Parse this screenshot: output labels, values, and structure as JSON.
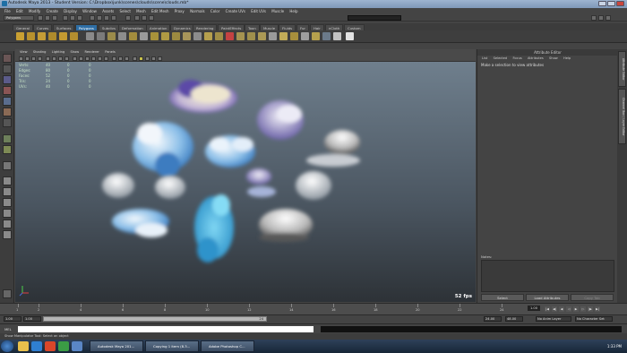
{
  "window": {
    "title": "Autodesk Maya 2013 - Student Version: C:\\Dropbox\\junk\\scenes\\clouds\\scene\\clouds.mb*"
  },
  "menubar": [
    "File",
    "Edit",
    "Modify",
    "Create",
    "Display",
    "Window",
    "Assets",
    "Select",
    "Mesh",
    "Edit Mesh",
    "Proxy",
    "Normals",
    "Color",
    "Create UVs",
    "Edit UVs",
    "Muscle",
    "Help"
  ],
  "status_line": {
    "mode": "Polygons"
  },
  "shelf_tabs": [
    "General",
    "Curves",
    "Surfaces",
    "Polygons",
    "Subdivs",
    "Deformation",
    "Animation",
    "Dynamics",
    "Rendering",
    "PaintEffects",
    "Toon",
    "Muscle",
    "Fluids",
    "Fur",
    "Hair",
    "nCloth",
    "Custom"
  ],
  "active_shelf_tab": "Polygons",
  "viewport": {
    "menu": [
      "View",
      "Shading",
      "Lighting",
      "Show",
      "Renderer",
      "Panels"
    ],
    "hud": [
      {
        "label": "Verts:",
        "v1": "40",
        "v2": "0",
        "v3": "0"
      },
      {
        "label": "Edges:",
        "v1": "80",
        "v2": "0",
        "v3": "0"
      },
      {
        "label": "Faces:",
        "v1": "52",
        "v2": "0",
        "v3": "0"
      },
      {
        "label": "Tris:",
        "v1": "24",
        "v2": "0",
        "v3": "0"
      },
      {
        "label": "UVs:",
        "v1": "40",
        "v2": "0",
        "v3": "0"
      }
    ],
    "fps": "52 fps"
  },
  "attribute_editor": {
    "title": "Attribute Editor",
    "menu": [
      "List",
      "Selected",
      "Focus",
      "Attributes",
      "Show",
      "Help"
    ],
    "hint": "Make a selection to view attributes",
    "notes_label": "Notes:",
    "buttons": {
      "select": "Select",
      "load": "Load Attributes",
      "copy": "Copy Tab"
    }
  },
  "side_tabs": [
    "Attribute Editor",
    "Channel Box / Layer Editor"
  ],
  "timeline": {
    "ticks": [
      "1",
      "2",
      "4",
      "6",
      "8",
      "10",
      "12",
      "14",
      "16",
      "18",
      "20",
      "22",
      "24"
    ],
    "current_frame": "1.00"
  },
  "range": {
    "start": "1.00",
    "inner_start": "1.00",
    "slider_label": "24",
    "end": "24.00",
    "outer_end": "48.00",
    "anim_layer": "No Anim Layer",
    "char_set": "No Character Set"
  },
  "command_line": {
    "label": "MEL"
  },
  "help_line": "Show Manipulator Tool: Select an object",
  "taskbar": {
    "tasks": [
      "Autodesk Maya 201...",
      "Copying 1 item (8.3...",
      "Adobe Photoshop C..."
    ],
    "clock": "1:33 PM"
  },
  "colors": {
    "active_tab": "#2e6ea5",
    "viewport_top": "#6f7f8d",
    "viewport_bottom": "#2d3237",
    "hud_text": "#c6e1c6"
  }
}
